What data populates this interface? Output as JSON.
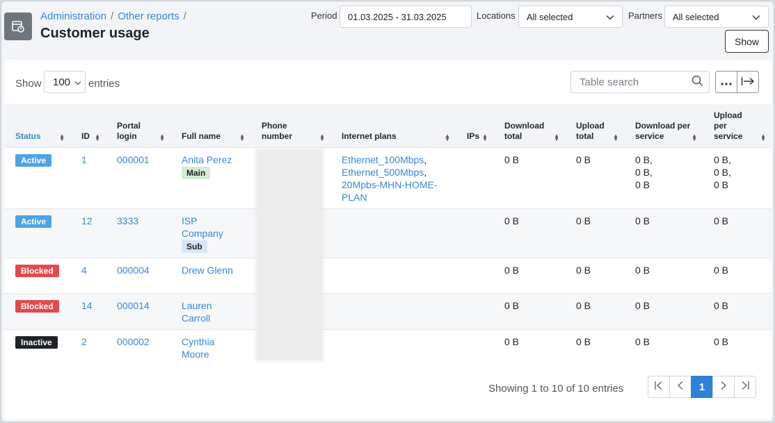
{
  "breadcrumb": [
    "Administration",
    "Other reports"
  ],
  "page_title": "Customer usage",
  "filters": {
    "period_label": "Period",
    "period_value": "01.03.2025 - 31.03.2025",
    "locations_label": "Locations",
    "locations_value": "All selected",
    "partners_label": "Partners",
    "partners_value": "All selected",
    "show_button": "Show"
  },
  "table_controls": {
    "show_label": "Show",
    "page_size": "100",
    "entries_label": "entries",
    "search_placeholder": "Table search"
  },
  "columns": [
    "Status",
    "ID",
    "Portal login",
    "Full name",
    "Phone number",
    "Internet plans",
    "IPs",
    "Download total",
    "Upload total",
    "Download per service",
    "Upload per service"
  ],
  "rows": [
    {
      "status": "Active",
      "id": "1",
      "login": "000001",
      "name": "Anita Perez",
      "tag": "Main",
      "plans": [
        "Ethernet_100Mbps",
        "Ethernet_500Mbps",
        "20Mpbs-MHN-HOME-PLAN"
      ],
      "ips": "",
      "dl_total": "0 B",
      "ul_total": "0 B",
      "dl_service": [
        "0 B,",
        "0 B,",
        "0 B"
      ],
      "ul_service": [
        "0 B,",
        "0 B,",
        "0 B"
      ]
    },
    {
      "status": "Active",
      "id": "12",
      "login": "3333",
      "name": "ISP Company",
      "tag": "Sub",
      "plans": [],
      "ips": "",
      "dl_total": "0 B",
      "ul_total": "0 B",
      "dl_service": [
        "0 B"
      ],
      "ul_service": [
        "0 B"
      ]
    },
    {
      "status": "Blocked",
      "id": "4",
      "login": "000004",
      "name": "Drew Glenn",
      "tag": "",
      "plans": [],
      "ips": "",
      "dl_total": "0 B",
      "ul_total": "0 B",
      "dl_service": [
        "0 B"
      ],
      "ul_service": [
        "0 B"
      ]
    },
    {
      "status": "Blocked",
      "id": "14",
      "login": "000014",
      "name": "Lauren Carroll",
      "tag": "",
      "plans": [],
      "ips": "",
      "dl_total": "0 B",
      "ul_total": "0 B",
      "dl_service": [
        "0 B"
      ],
      "ul_service": [
        "0 B"
      ]
    },
    {
      "status": "Inactive",
      "id": "2",
      "login": "000002",
      "name": "Cynthia Moore",
      "tag": "",
      "plans": [],
      "ips": "",
      "dl_total": "0 B",
      "ul_total": "0 B",
      "dl_service": [
        "0 B"
      ],
      "ul_service": [
        "0 B"
      ]
    }
  ],
  "footer": {
    "info": "Showing 1 to 10 of 10 entries",
    "current_page": "1"
  },
  "colors": {
    "accent": "#3a86d6",
    "active": "#4ea3e6",
    "blocked": "#e5484d",
    "inactive": "#1f2328"
  }
}
